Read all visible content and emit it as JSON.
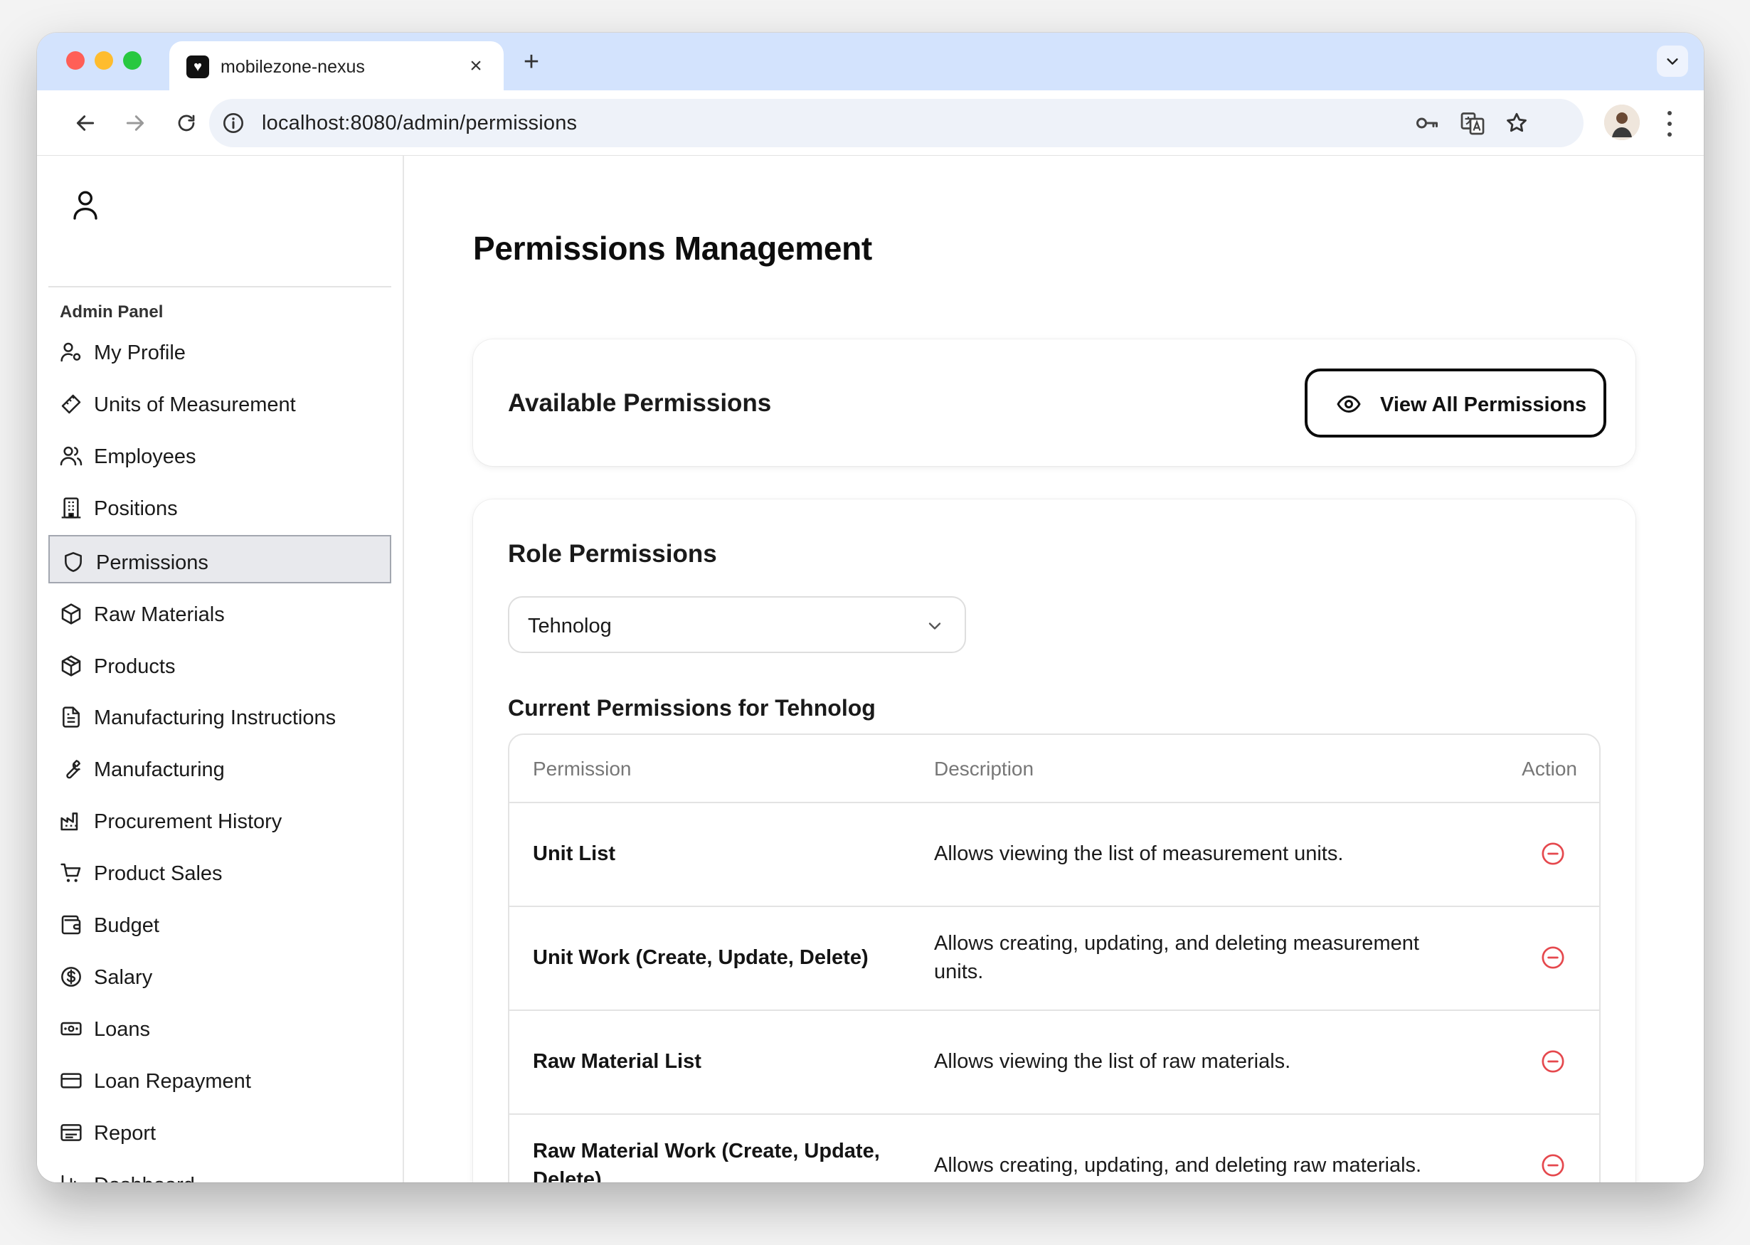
{
  "browser": {
    "tab_title": "mobilezone-nexus",
    "url": "localhost:8080/admin/permissions"
  },
  "sidebar": {
    "heading": "Admin Panel",
    "items": [
      {
        "label": "My Profile",
        "icon": "user-cog-icon"
      },
      {
        "label": "Units of Measurement",
        "icon": "ruler-icon"
      },
      {
        "label": "Employees",
        "icon": "users-icon"
      },
      {
        "label": "Positions",
        "icon": "building-icon"
      },
      {
        "label": "Permissions",
        "icon": "shield-icon",
        "active": true
      },
      {
        "label": "Raw Materials",
        "icon": "box-icon"
      },
      {
        "label": "Products",
        "icon": "package-icon"
      },
      {
        "label": "Manufacturing Instructions",
        "icon": "file-text-icon"
      },
      {
        "label": "Manufacturing",
        "icon": "wrench-icon"
      },
      {
        "label": "Procurement History",
        "icon": "factory-icon"
      },
      {
        "label": "Product Sales",
        "icon": "cart-icon"
      },
      {
        "label": "Budget",
        "icon": "wallet-icon"
      },
      {
        "label": "Salary",
        "icon": "dollar-circle-icon"
      },
      {
        "label": "Loans",
        "icon": "banknote-icon"
      },
      {
        "label": "Loan Repayment",
        "icon": "credit-card-icon"
      },
      {
        "label": "Report",
        "icon": "report-icon"
      },
      {
        "label": "Dashboard",
        "icon": "bar-chart-icon"
      }
    ]
  },
  "main": {
    "title": "Permissions Management",
    "available": {
      "title": "Available Permissions",
      "button_label": "View All Permissions"
    },
    "role": {
      "title": "Role Permissions",
      "selected_role": "Tehnolog",
      "current_title": "Current Permissions for Tehnolog"
    },
    "table": {
      "headers": {
        "permission": "Permission",
        "description": "Description",
        "action": "Action"
      },
      "rows": [
        {
          "permission": "Unit List",
          "description": "Allows viewing the list of measurement units."
        },
        {
          "permission": "Unit Work (Create, Update, Delete)",
          "description": "Allows creating, updating, and deleting measurement units."
        },
        {
          "permission": "Raw Material List",
          "description": "Allows viewing the list of raw materials."
        },
        {
          "permission": "Raw Material Work (Create, Update, Delete)",
          "description": "Allows creating, updating, and deleting raw materials."
        }
      ]
    }
  },
  "colors": {
    "accent_remove": "#e5484d",
    "tabstrip": "#d3e3fd",
    "active_item_bg": "#e8e9ed"
  }
}
